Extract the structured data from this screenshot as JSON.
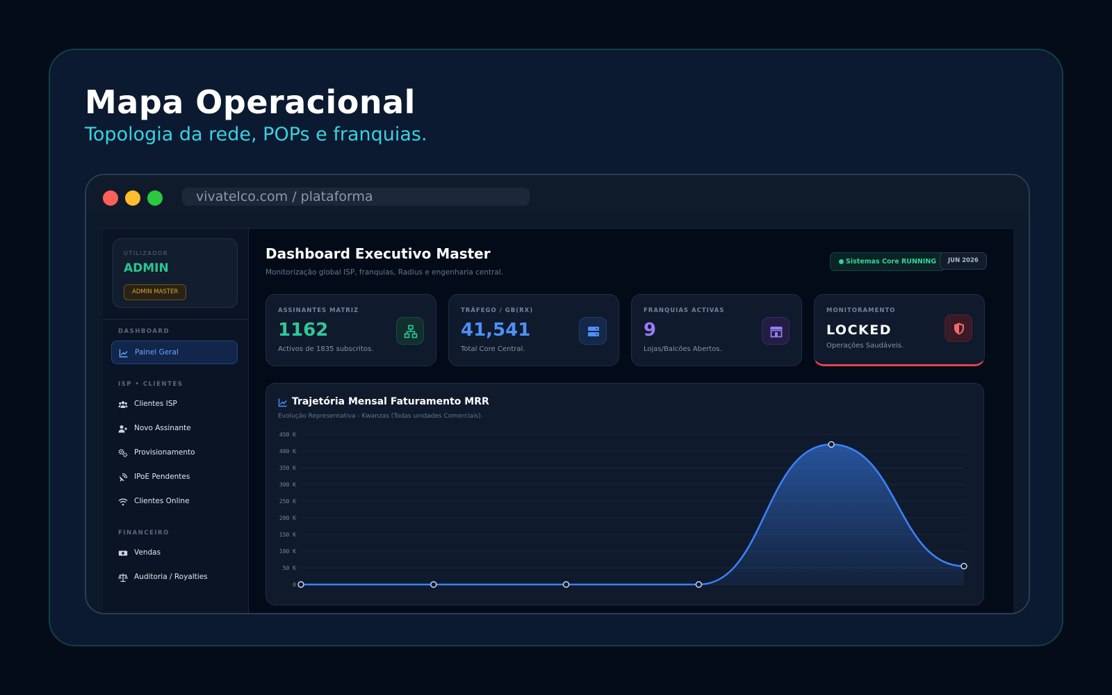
{
  "hero": {
    "title": "Mapa Operacional",
    "subtitle": "Topologia da rede, POPs e franquias."
  },
  "browser": {
    "address": "vivatelco.com / plataforma"
  },
  "sidebar": {
    "user": {
      "label": "UTILIZADOR",
      "name": "ADMIN",
      "role_badge": "ADMIN MASTER"
    },
    "sections": [
      {
        "title": "DASHBOARD",
        "items": [
          {
            "label": "Painel Geral",
            "icon": "chart-line-icon",
            "active": true
          }
        ]
      },
      {
        "title": "ISP • CLIENTES",
        "items": [
          {
            "label": "Clientes ISP",
            "icon": "users-icon"
          },
          {
            "label": "Novo Assinante",
            "icon": "user-plus-icon"
          },
          {
            "label": "Provisionamento",
            "icon": "gears-icon"
          },
          {
            "label": "IPoE Pendentes",
            "icon": "satellite-dish-icon"
          },
          {
            "label": "Clientes Online",
            "icon": "wifi-icon"
          }
        ]
      },
      {
        "title": "FINANCEIRO",
        "items": [
          {
            "label": "Vendas",
            "icon": "money-bill-icon"
          },
          {
            "label": "Auditoria / Royalties",
            "icon": "scale-balance-icon"
          }
        ]
      }
    ]
  },
  "header": {
    "title": "Dashboard Executivo Master",
    "subtitle": "Monitorização global ISP, franquias, Radius e engenharia central.",
    "status": "Sistemas Core RUNNING",
    "period": "JUN 2026"
  },
  "kpis": [
    {
      "label": "ASSINANTES MATRIZ",
      "value": "1162",
      "note": "Activos de 1835 subscritos.",
      "icon": "network-icon",
      "color": "#2ec99a"
    },
    {
      "label": "TRÁFEGO / GB(RX)",
      "value": "41,541",
      "note": "Total Core Central.",
      "icon": "server-icon",
      "color": "#4f8ff7"
    },
    {
      "label": "FRANQUIAS ACTIVAS",
      "value": "9",
      "note": "Lojas/Balcões Abertos.",
      "icon": "store-icon",
      "color": "#9a7cf5"
    },
    {
      "label": "MONITORAMENTO",
      "value": "LOCKED",
      "note": "Operações Saudáveis.",
      "icon": "shield-icon",
      "color": "#ffffff"
    }
  ],
  "chart": {
    "title": "Trajetória Mensal Faturamento MRR",
    "subtitle": "Evolução Representativa - Kwanzas (Todas unidades Comerciais)."
  },
  "chart_data": {
    "type": "area",
    "title": "Trajetória Mensal Faturamento MRR",
    "subtitle": "Evolução Representativa - Kwanzas (Todas unidades Comerciais).",
    "y_ticks": [
      "0",
      "50 K",
      "100 K",
      "150 K",
      "200 K",
      "250 K",
      "300 K",
      "350 K",
      "400 K",
      "450 K"
    ],
    "ylim": [
      0,
      450000
    ],
    "grid": true,
    "series": [
      {
        "values": [
          0,
          0,
          0,
          0,
          420000,
          55000
        ],
        "color": "#3b82f6"
      }
    ]
  }
}
